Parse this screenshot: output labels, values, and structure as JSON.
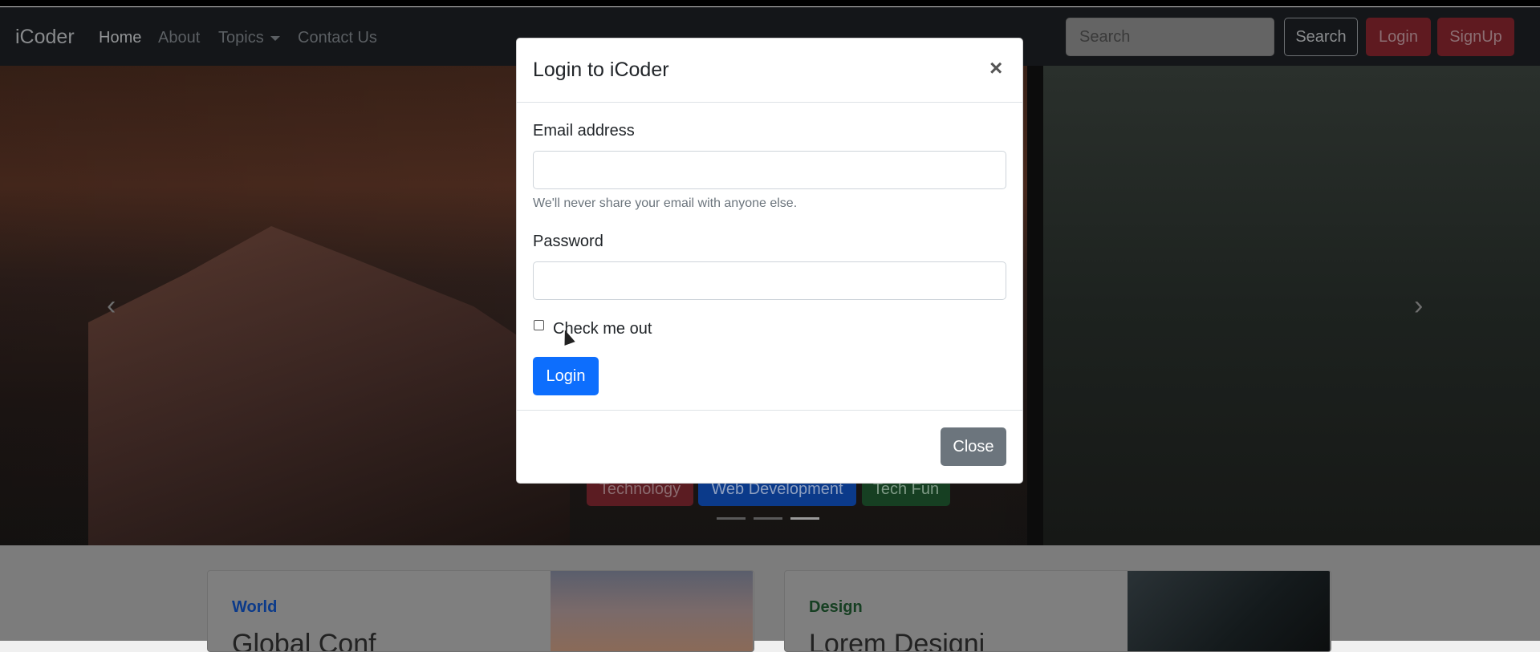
{
  "navbar": {
    "brand": "iCoder",
    "links": [
      {
        "label": "Home"
      },
      {
        "label": "About"
      },
      {
        "label": "Topics"
      },
      {
        "label": "Contact Us"
      }
    ],
    "search_placeholder": "Search",
    "search_button": "Search",
    "login_button": "Login",
    "signup_button": "SignUp"
  },
  "hero": {
    "tags": [
      {
        "label": "Technology",
        "color": "#5b1c22",
        "text_color": "#8b6c70"
      },
      {
        "label": "Web Development",
        "color": "#0b3a8a",
        "text_color": "#8fa0c0"
      },
      {
        "label": "Tech Fun",
        "color": "#163f22",
        "text_color": "#7f9a86"
      }
    ],
    "active_slide": 3,
    "slide_count": 3
  },
  "cards": [
    {
      "category": "World",
      "category_color": "#0b3a8a",
      "title": "Global Conf"
    },
    {
      "category": "Design",
      "category_color": "#163f22",
      "title": "Lorem Designi"
    }
  ],
  "modal": {
    "title": "Login to iCoder",
    "email_label": "Email address",
    "email_value": "",
    "email_help": "We'll never share your email with anyone else.",
    "password_label": "Password",
    "password_value": "",
    "checkbox_label": "Check me out",
    "checkbox_checked": false,
    "submit_label": "Login",
    "close_label": "Close",
    "close_symbol": "×"
  }
}
